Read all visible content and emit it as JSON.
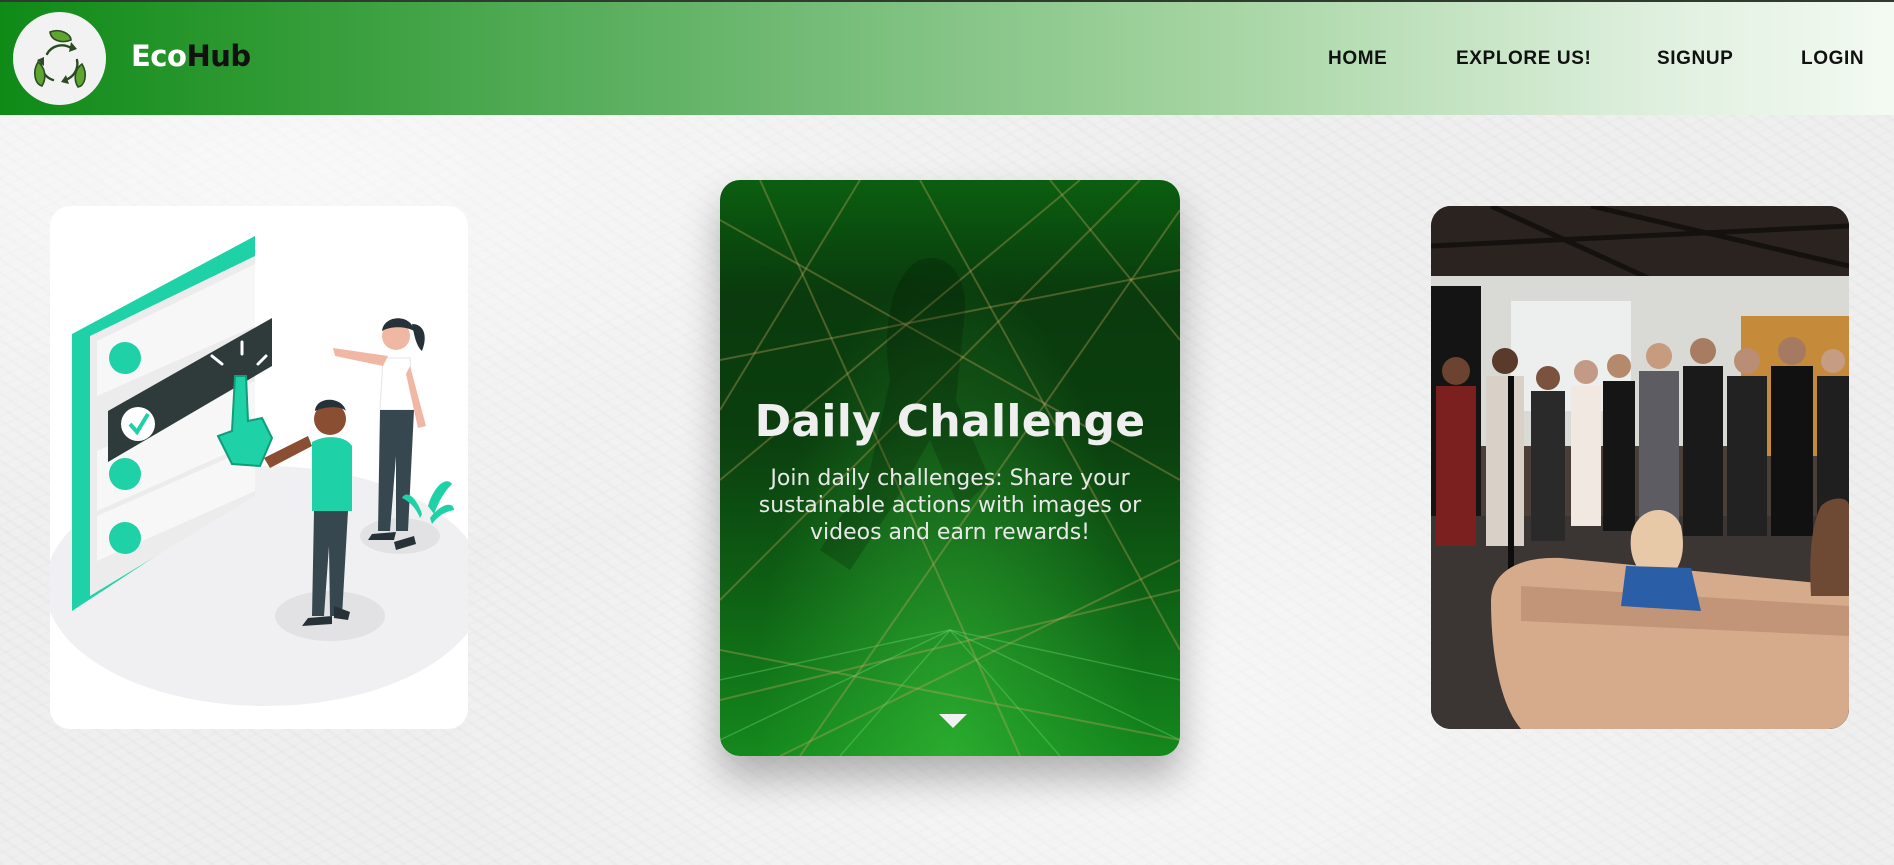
{
  "brand": {
    "eco": "Eco",
    "hub": "Hub"
  },
  "nav": [
    {
      "label": "HOME"
    },
    {
      "label": "EXPLORE US!"
    },
    {
      "label": "SIGNUP"
    },
    {
      "label": "LOGIN"
    }
  ],
  "cards": {
    "center": {
      "title": "Daily Challenge",
      "description": "Join daily challenges: Share your sustainable actions with images or videos and earn rewards!"
    }
  },
  "colors": {
    "header_start": "#0f8a17",
    "header_end": "#f3faf2",
    "accent_teal": "#1fd1a6",
    "card_green": "#0e5e14"
  },
  "icons": {
    "logo": "recycle-leaves-icon",
    "card_arrow": "triangle-down-icon"
  }
}
